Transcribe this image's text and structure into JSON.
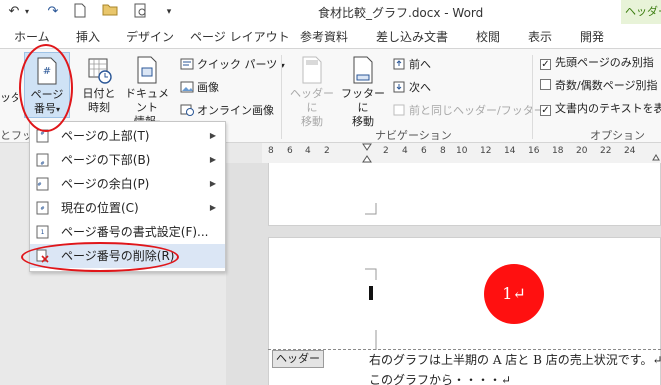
{
  "window": {
    "title": "食材比較_グラフ.docx - Word",
    "context_tab": "ヘッダー"
  },
  "tabs": [
    "ホーム",
    "挿入",
    "デザイン",
    "ページ レイアウト",
    "参考資料",
    "差し込み文書",
    "校閲",
    "表示",
    "開発"
  ],
  "ribbon": {
    "header_partial": "ッダー",
    "page_number": {
      "line1": "ページ",
      "line2": "番号"
    },
    "date_time": {
      "line1": "日付と",
      "line2": "時刻"
    },
    "doc_info": {
      "line1": "ドキュメント",
      "line2": "情報"
    },
    "quick_parts": "クイック パーツ",
    "picture": "画像",
    "online_picture": "オンライン画像",
    "goto_header": {
      "line1": "ヘッダーに",
      "line2": "移動"
    },
    "goto_footer": {
      "line1": "フッターに",
      "line2": "移動"
    },
    "prev": "前へ",
    "next": "次へ",
    "link_prev": "前と同じヘッダー/フッター",
    "nav_group": "ナビゲーション",
    "options_group": "オプション",
    "hf_group_partial": "とフッ",
    "options": [
      {
        "label": "先頭ページのみ別指",
        "checked": true
      },
      {
        "label": "奇数/偶数ページ別指",
        "checked": false
      },
      {
        "label": "文書内のテキストを表",
        "checked": true
      }
    ]
  },
  "ruler": [
    "8",
    "6",
    "4",
    "2",
    "2",
    "4",
    "6",
    "8",
    "10",
    "12",
    "14",
    "16",
    "18",
    "20",
    "22",
    "24"
  ],
  "menu": {
    "items": [
      {
        "label": "ページの上部(T)",
        "submenu": true
      },
      {
        "label": "ページの下部(B)",
        "submenu": true
      },
      {
        "label": "ページの余白(P)",
        "submenu": true
      },
      {
        "label": "現在の位置(C)",
        "submenu": true
      },
      {
        "label": "ページ番号の書式設定(F)...",
        "submenu": false
      },
      {
        "label": "ページ番号の削除(R)",
        "submenu": false
      }
    ]
  },
  "document": {
    "header_tag": "ヘッダー",
    "step_number": "1↵",
    "line1": "右のグラフは上半期の A 店と B 店の売上状況です。↵",
    "line2": "このグラフから・・・・↵"
  },
  "colors": {
    "annotation": "#e0161a",
    "highlight": "#dbe6f5",
    "context_tab_bg": "#e8f3d8",
    "context_tab_text": "#3b7d0f"
  }
}
